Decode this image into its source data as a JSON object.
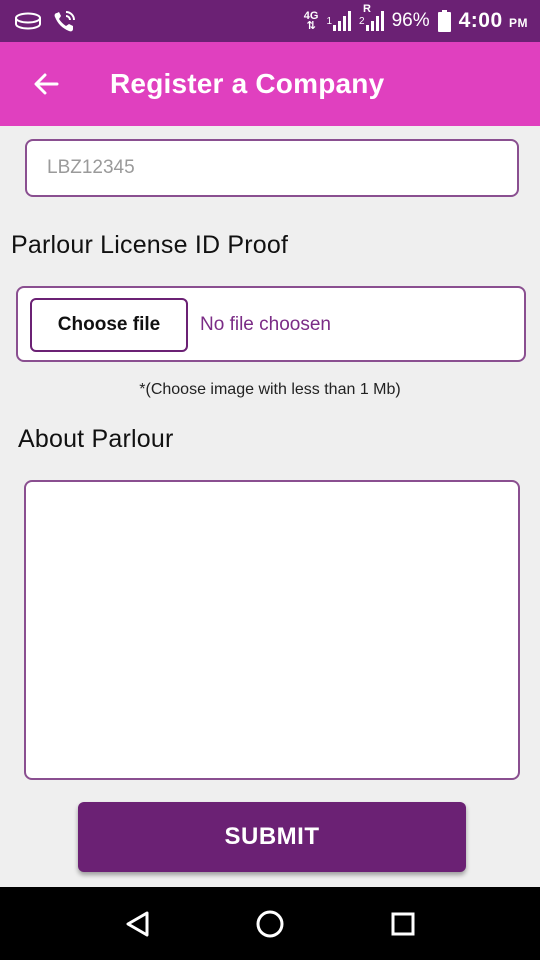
{
  "status_bar": {
    "network_type": "4G",
    "sim1_label": "1",
    "sim2_label": "2",
    "roaming_label": "R",
    "battery_percent": "96%",
    "time": "4:00",
    "time_suffix": "PM"
  },
  "app_bar": {
    "title": "Register a Company",
    "back_icon": "arrow-left-icon",
    "background": "#e040bf"
  },
  "form": {
    "license_id": {
      "placeholder": "LBZ12345",
      "value": ""
    },
    "proof_label": "Parlour License ID Proof",
    "choose_file_label": "Choose file",
    "no_file_text": "No file choosen",
    "file_hint": "*(Choose image with less than 1 Mb)",
    "about_label": "About Parlour",
    "about_value": "",
    "submit_label": "SUBMIT"
  },
  "nav_bar": {
    "back_icon": "triangle-back-icon",
    "home_icon": "circle-home-icon",
    "recents_icon": "square-recents-icon"
  },
  "colors": {
    "status_bar": "#6b2174",
    "accent": "#e040bf",
    "primary": "#6b2174",
    "border": "#8a4f90",
    "link_text": "#7b2c86"
  }
}
